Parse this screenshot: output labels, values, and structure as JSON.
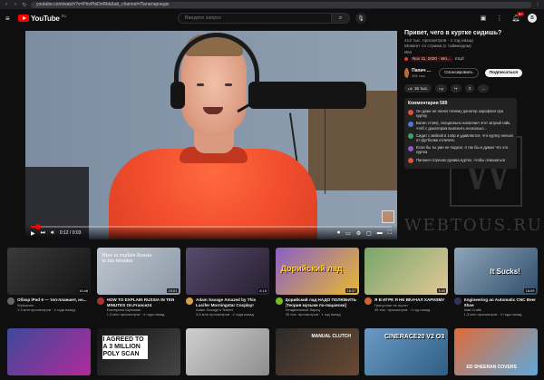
{
  "browser": {
    "url": "youtube.com/watch?v=PhvPbiDnRbk&ab_channel=Палатарнедю",
    "back_icon": "back-arrow-icon",
    "forward_icon": "forward-arrow-icon",
    "reload_icon": "reload-icon"
  },
  "header": {
    "logo_text": "YouTube",
    "region": "RU",
    "search_placeholder": "Введите запрос",
    "notification_count": "9+",
    "user_initial": "В"
  },
  "player": {
    "time": "0:12 / 0:03",
    "progress_fraction": 0.02
  },
  "video": {
    "title": "Привет, чего в куртке сидишь?",
    "views_date": "412 тыс. просмотров · 1 год назад",
    "stream_meta": "Момент со стрима (с таймкодом)",
    "tag_badge": "Ивл",
    "tag_text": "Nov 11, 2020 · Wo...",
    "more": "ЕЩЁ"
  },
  "channel": {
    "name": "Папич ...",
    "subs": "251 тыс.",
    "sponsor_label": "Спонсировать",
    "subscribe_label": "Подписаться"
  },
  "actions": {
    "like_count": "15 тыс.",
    "dislike_label": "",
    "share_label": "",
    "save_label": "",
    "more_label": "..."
  },
  "comments": {
    "header": "Комментарии 589",
    "items": [
      {
        "text": "Он даже не понял почему донатер зарофлил про куртку",
        "color": "#d9553a"
      },
      {
        "text": "Батин стояк), специально наполнил этот затрый гайк, чтоб с донатером выяснить несколько...",
        "color": "#4a78d0"
      },
      {
        "text": "Сидит с вебкой в 144р и удивляется, что куртку нельзя от футболки отличить",
        "color": "#3aa565"
      },
      {
        "text": "Если бы ты умн не подкол, я так бы и думал что это куртка",
        "color": "#8b5cc8"
      },
      {
        "text": "Папанич отрезал рукава куртке, чтобы отмазаться",
        "color": "#d9553a"
      }
    ]
  },
  "watermark": {
    "letter": "W",
    "text": "WEBTOUS.RU"
  },
  "cards": [
    {
      "title": "Обзор iPad 6 — топ-планшет, но...",
      "channel": "Wylsacom",
      "stats": "1.3 млн просмотров · 4 года назад",
      "duration": "10:48",
      "caption": ""
    },
    {
      "title": "HOW TO EXPLAIN RUSSIA IN TEN MINUTES On.France24",
      "channel": "Екатерина Шульман",
      "stats": "1,3 млн просмотров · 4 года назад",
      "duration": "10:01",
      "caption": "How to explain Russia in ten minutes"
    },
    {
      "title": "Adam Savage Amazed by This Lucifer Morningstar Cosplay!",
      "channel": "Adam Savage's Tested",
      "stats": "3,6 млн просмотров · 4 года назад",
      "duration": "6:15",
      "caption": ""
    },
    {
      "title": "Дорийский лад НАДО ПОЛЮБИТЬ [Теория музыки по-пацански]",
      "channel": "Неидеальный Ларец",
      "stats": "46 тыс. просмотров · 1 год назад",
      "duration": "16:37",
      "caption": "Дорийский лад"
    },
    {
      "title": "Я В ИГРЕ Я НЕ ВКАЧАЛ ХАРИЗМУ",
      "channel": "Гринуслан не шутит",
      "stats": "45 тыс. просмотров · 1 год назад",
      "duration": "3:40",
      "caption": ""
    },
    {
      "title": "Engineering an Automatic CNC Beer Shoe",
      "channel": "Mad Crafts",
      "stats": "1,3 млн просмотров · 2 года назад",
      "duration": "18:09",
      "caption": "It Sucks!"
    },
    {
      "title": "",
      "channel": "",
      "stats": "",
      "duration": "",
      "caption": ""
    },
    {
      "title": "",
      "channel": "",
      "stats": "",
      "duration": "",
      "caption": "I AGREED TO A 3 MILLION POLY SCAN"
    },
    {
      "title": "",
      "channel": "",
      "stats": "",
      "duration": "",
      "caption": ""
    },
    {
      "title": "",
      "channel": "",
      "stats": "",
      "duration": "",
      "caption": "MANUAL CLUTCH"
    },
    {
      "title": "",
      "channel": "",
      "stats": "",
      "duration": "",
      "caption": "CINERACE20 V2 O3"
    },
    {
      "title": "",
      "channel": "",
      "stats": "",
      "duration": "",
      "caption": "ED SHEERAN COVERS"
    }
  ]
}
